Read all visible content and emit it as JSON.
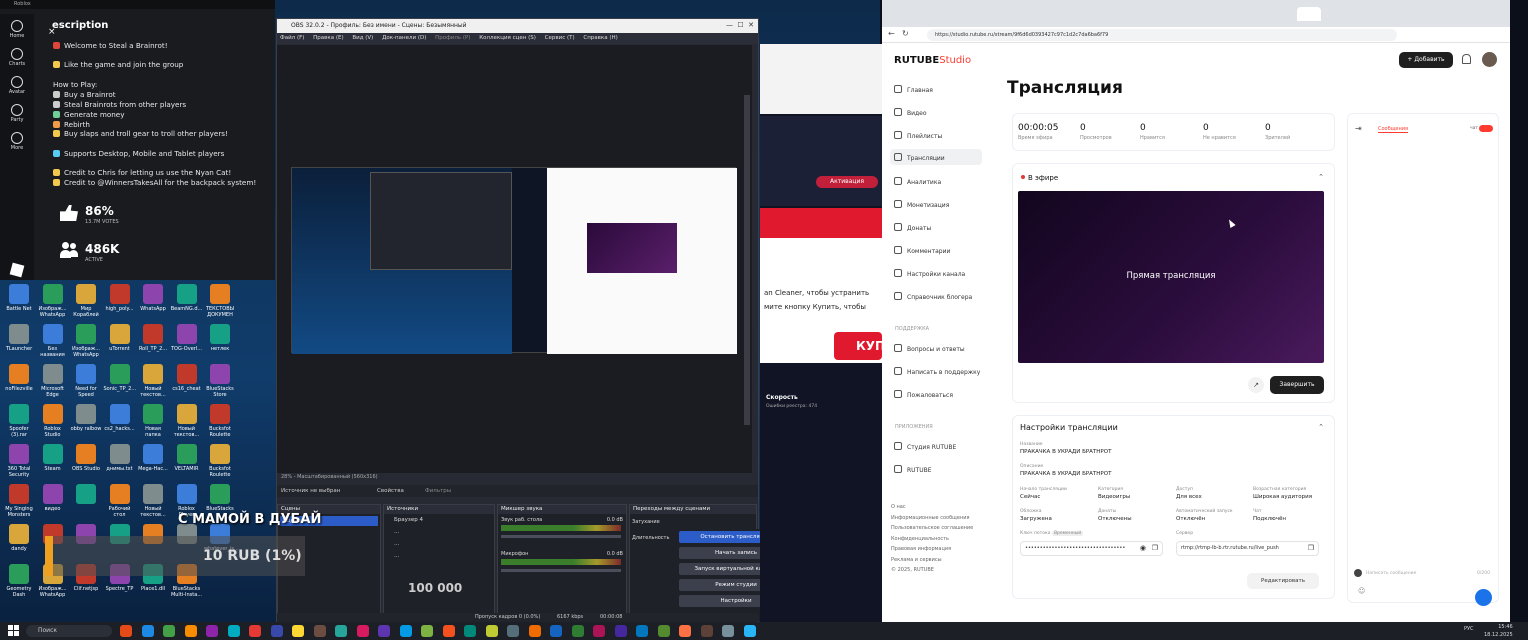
{
  "roblox": {
    "title": "Roblox",
    "heading": "escription",
    "lines": [
      "Welcome to Steal a Brainrot!",
      "Like the game and join the group",
      "How to Play:",
      "Buy a Brainrot",
      "Steal Brainrots from other players",
      "Generate money",
      "Rebirth",
      "Buy slaps and troll gear to troll other players!",
      "Supports Desktop, Mobile and Tablet players",
      "Credit to Chris for letting us use the Nyan Cat!",
      "Credit to @WinnersTakesAll for the backpack system!"
    ],
    "like_pct": "86%",
    "votes": "13.7M VOTES",
    "active": "486K",
    "active_label": "ACTIVE",
    "sidebar": [
      "Home",
      "Charts",
      "Avatar",
      "Party",
      "More"
    ]
  },
  "desktop_icons": [
    "Battle Net",
    "Изображ... WhatsApp",
    "Мир Кораблей",
    "high_poly...",
    "WhatsApp",
    "BeamNG.d...",
    "ТЕКСТОВЫ ДОКУМЕН",
    "TLauncher",
    "Без названия",
    "Изображ... WhatsApp",
    "uTorrent",
    "Roll_TP_2...",
    "TOG-Overl...",
    "нетлек",
    "noFilezville",
    "Microsoft Edge",
    "Need for Speed",
    "Sonic_TP_2...",
    "Новый текстов...",
    "cs16_cheat",
    "BlueStacks Store",
    "Spoofer (3).rar",
    "Roblox Studio",
    "obby ralbow",
    "cs2_hacks...",
    "Новая папка",
    "Новый текстов...",
    "Bucksfot Roulette",
    "360 Total Security",
    "Steam",
    "OBS Studio",
    "днимы.txt",
    "Mega-Hac...",
    "VELTAMIR",
    "Bucksfot Roulette",
    "My Singing Monsters",
    "видео",
    "",
    "Рабочий стол",
    "Новый текстов...",
    "Roblox Player",
    "BlueStacks",
    "dandy",
    "",
    "",
    "",
    "",
    "",
    "whatever_is...",
    "Geometry Dash",
    "Изображ... WhatsApp",
    "Clif.netjsp",
    "Spectre_TP",
    "Place1.dll",
    "BlueStacks Multi-Insta..."
  ],
  "obs": {
    "title": "OBS 32.0.2 - Профиль: Без имени - Сцены: Безымянный",
    "menu": [
      "Файл (F)",
      "Правка (E)",
      "Вид (V)",
      "Док-панели (D)",
      "Профиль (P)",
      "Коллекция сцен (S)",
      "Сервис (T)",
      "Справка (H)"
    ],
    "source_bar": "Источник не выбран",
    "properties": "Свойства",
    "filters": "Фильтры",
    "zoom": "28% - Масштабированный (560х316)",
    "scenes_title": "Сцены",
    "scene_name": "Сцена",
    "sources_title": "Источники",
    "sources": [
      "Браузер 4",
      "...",
      "...",
      "..."
    ],
    "mixer_title": "Микшер звука",
    "mixer_ch1": "Звук раб. стола",
    "mixer_ch1_db": "0.0 dB",
    "mixer_ch2": "Микрофон",
    "mixer_ch2_db": "0.0 dB",
    "transitions_title": "Переходы между сценами",
    "fade": "Затухание",
    "duration": "Длительность",
    "controls": [
      "Остановить трансляцию",
      "Начать запись",
      "Запуск виртуальной камеры",
      "Режим студии",
      "Настройки"
    ],
    "status": "Пропуск кадров 0 (0.0%)",
    "bitrate": "6167 kbps",
    "time": "00:00:08",
    "overlay_title": "С МАМОЙ В ДУБАЙ",
    "overlay_amount": "10 RUB (1%)",
    "overlay_goal": "100 000"
  },
  "middle": {
    "activate": "Активация",
    "text1": "an Cleaner, чтобы устранить",
    "text2": "мите кнопку Купить, чтобы",
    "buy": "КУП",
    "speed": "Скорость",
    "speed_sub": "Ошибки реестра: 474"
  },
  "browser": {
    "url": "https://studio.rutube.ru/stream/9f6d6d0393427c97c1d2c7da6ba6f79",
    "logo_main": "RUTUBE",
    "logo_studio": "Studio",
    "add_button": "+ Добавить",
    "nav": [
      "Главная",
      "Видео",
      "Плейлисты",
      "Трансляции",
      "Аналитика",
      "Монетизация",
      "Донаты",
      "Комментарии",
      "Настройки канала",
      "Справочник блогера"
    ],
    "support_label": "ПОДДЕРЖКА",
    "support": [
      "Вопросы и ответы",
      "Написать в поддержку",
      "Пожаловаться"
    ],
    "apps_label": "ПРИЛОЖЕНИЯ",
    "apps": [
      "Студия RUTUBE",
      "RUTUBE"
    ],
    "footer": [
      "О нас",
      "Информационные сообщения",
      "Пользовательское соглашение",
      "Конфиденциальность",
      "Правовая информация",
      "Реклама и сервисы",
      "© 2025, RUTUBE"
    ],
    "page_title": "Трансляция",
    "stats": [
      {
        "value": "00:00:05",
        "label": "Время эфира"
      },
      {
        "value": "0",
        "label": "Просмотров"
      },
      {
        "value": "0",
        "label": "Нравится"
      },
      {
        "value": "0",
        "label": "Не нравится"
      },
      {
        "value": "0",
        "label": "Зрителей"
      }
    ],
    "live_label": "В эфире",
    "preview_text": "Прямая трансляция",
    "finish_button": "Завершить",
    "settings_title": "Настройки трансляции",
    "name_label": "Название",
    "name_value": "ПРАКАЧКА В УКРАДИ БРАТНРОТ",
    "desc_label": "Описание",
    "desc_value": "ПРАКАЧКА В УКРАДИ БРАТНРОТ",
    "fields": [
      {
        "label": "Начало трансляции",
        "value": "Сейчас"
      },
      {
        "label": "Категория",
        "value": "Видеоигры"
      },
      {
        "label": "Доступ",
        "value": "Для всех"
      },
      {
        "label": "Возрастная категория",
        "value": "Широкая аудитория"
      },
      {
        "label": "Обложка",
        "value": "Загружена"
      },
      {
        "label": "Донаты",
        "value": "Отключены"
      },
      {
        "label": "Автоматический запуск",
        "value": "Отключён"
      },
      {
        "label": "Чат",
        "value": "Подключён"
      }
    ],
    "key_label": "Ключ потока",
    "key_badge": "Временный",
    "key_value": "••••••••••••••••••••••••••••••••••",
    "server_label": "Сервер",
    "server_value": "rtmp://rtmp-lb-b.rtr.rutube.ru/live_push",
    "edit_button": "Редактировать",
    "chat_tab": "Сообщения",
    "chat_toggle": "чат",
    "chat_placeholder": "Написать сообщение",
    "chat_counter": "0/200"
  },
  "taskbar": {
    "search": "Поиск",
    "lang": "РУС",
    "time": "15:46",
    "date": "18.12.2025"
  },
  "colors": {
    "rutube_red": "#ff3b30",
    "obs_blue": "#2b5cc7",
    "live_dot": "#e53935"
  }
}
